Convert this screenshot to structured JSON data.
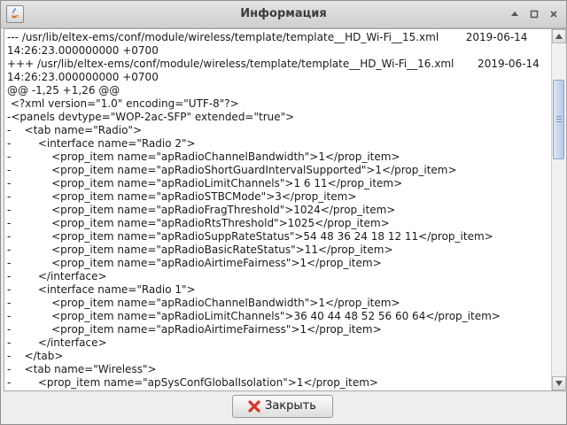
{
  "window": {
    "title": "Информация",
    "buttons": [
      "Развернуть",
      "Восстановить",
      "Закрыть окно"
    ]
  },
  "diff": {
    "lines": [
      "--- /usr/lib/eltex-ems/conf/module/wireless/template/template__HD_Wi-Fi__15.xml        2019-06-14",
      "14:26:23.000000000 +0700",
      "+++ /usr/lib/eltex-ems/conf/module/wireless/template/template__HD_Wi-Fi__16.xml       2019-06-14",
      "14:26:23.000000000 +0700",
      "@@ -1,25 +1,26 @@",
      " <?xml version=\"1.0\" encoding=\"UTF-8\"?>",
      "-<panels devtype=\"WOP-2ac-SFP\" extended=\"true\">",
      "-    <tab name=\"Radio\">",
      "-        <interface name=\"Radio 2\">",
      "-            <prop_item name=\"apRadioChannelBandwidth\">1</prop_item>",
      "-            <prop_item name=\"apRadioShortGuardIntervalSupported\">1</prop_item>",
      "-            <prop_item name=\"apRadioLimitChannels\">1 6 11</prop_item>",
      "-            <prop_item name=\"apRadioSTBCMode\">3</prop_item>",
      "-            <prop_item name=\"apRadioFragThreshold\">1024</prop_item>",
      "-            <prop_item name=\"apRadioRtsThreshold\">1025</prop_item>",
      "-            <prop_item name=\"apRadioSuppRateStatus\">54 48 36 24 18 12 11</prop_item>",
      "-            <prop_item name=\"apRadioBasicRateStatus\">11</prop_item>",
      "-            <prop_item name=\"apRadioAirtimeFairness\">1</prop_item>",
      "-        </interface>",
      "-        <interface name=\"Radio 1\">",
      "-            <prop_item name=\"apRadioChannelBandwidth\">1</prop_item>",
      "-            <prop_item name=\"apRadioLimitChannels\">36 40 44 48 52 56 60 64</prop_item>",
      "-            <prop_item name=\"apRadioAirtimeFairness\">1</prop_item>",
      "-        </interface>",
      "-    </tab>",
      "-    <tab name=\"Wireless\">",
      "-        <prop_item name=\"apSysConfGlobalIsolation\">1</prop_item>"
    ]
  },
  "footer": {
    "close_label": "Закрыть"
  },
  "colors": {
    "close_icon": "#d9342b"
  }
}
